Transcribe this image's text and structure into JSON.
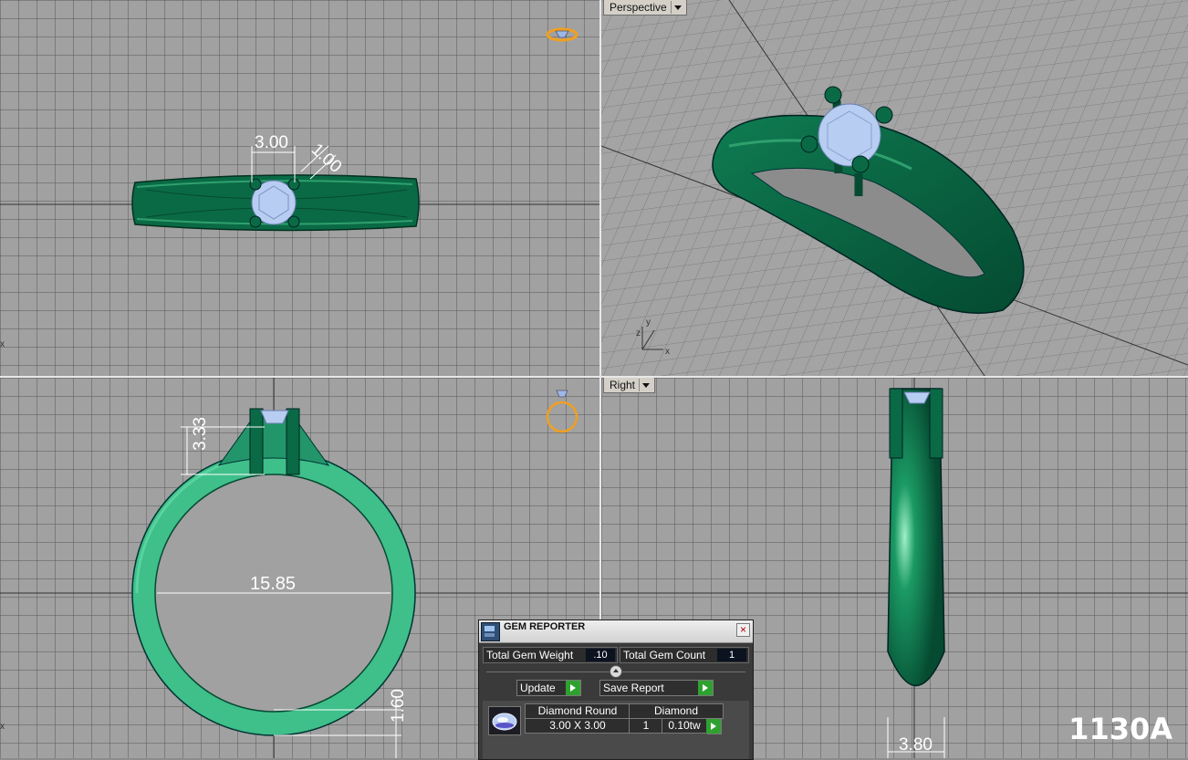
{
  "viewports": {
    "top_left": {
      "dimensions": [
        "3.00",
        "1.00"
      ]
    },
    "perspective": {
      "label": "Perspective",
      "axes": {
        "x": "x",
        "y": "y",
        "z": "z"
      }
    },
    "bottom_left": {
      "dimensions": [
        "3.33",
        "15.85",
        "1.60"
      ]
    },
    "right": {
      "label": "Right",
      "dimensions": [
        "3.80"
      ]
    }
  },
  "gem_reporter": {
    "title": "GEM REPORTER",
    "total_weight_label": "Total Gem Weight",
    "total_weight_value": ".10",
    "total_count_label": "Total Gem Count",
    "total_count_value": "1",
    "update_label": "Update",
    "save_report_label": "Save Report",
    "columns": [
      "Diamond Round",
      "Diamond"
    ],
    "row": {
      "size": "3.00 X 3.00",
      "count": "1",
      "weight": "0.10tw"
    }
  },
  "model_code": "1130A",
  "colors": {
    "metal": "#0a6a45",
    "gem": "#b8cdf2",
    "grid": "#a1a1a1",
    "icon_gold": "#f0a020"
  }
}
